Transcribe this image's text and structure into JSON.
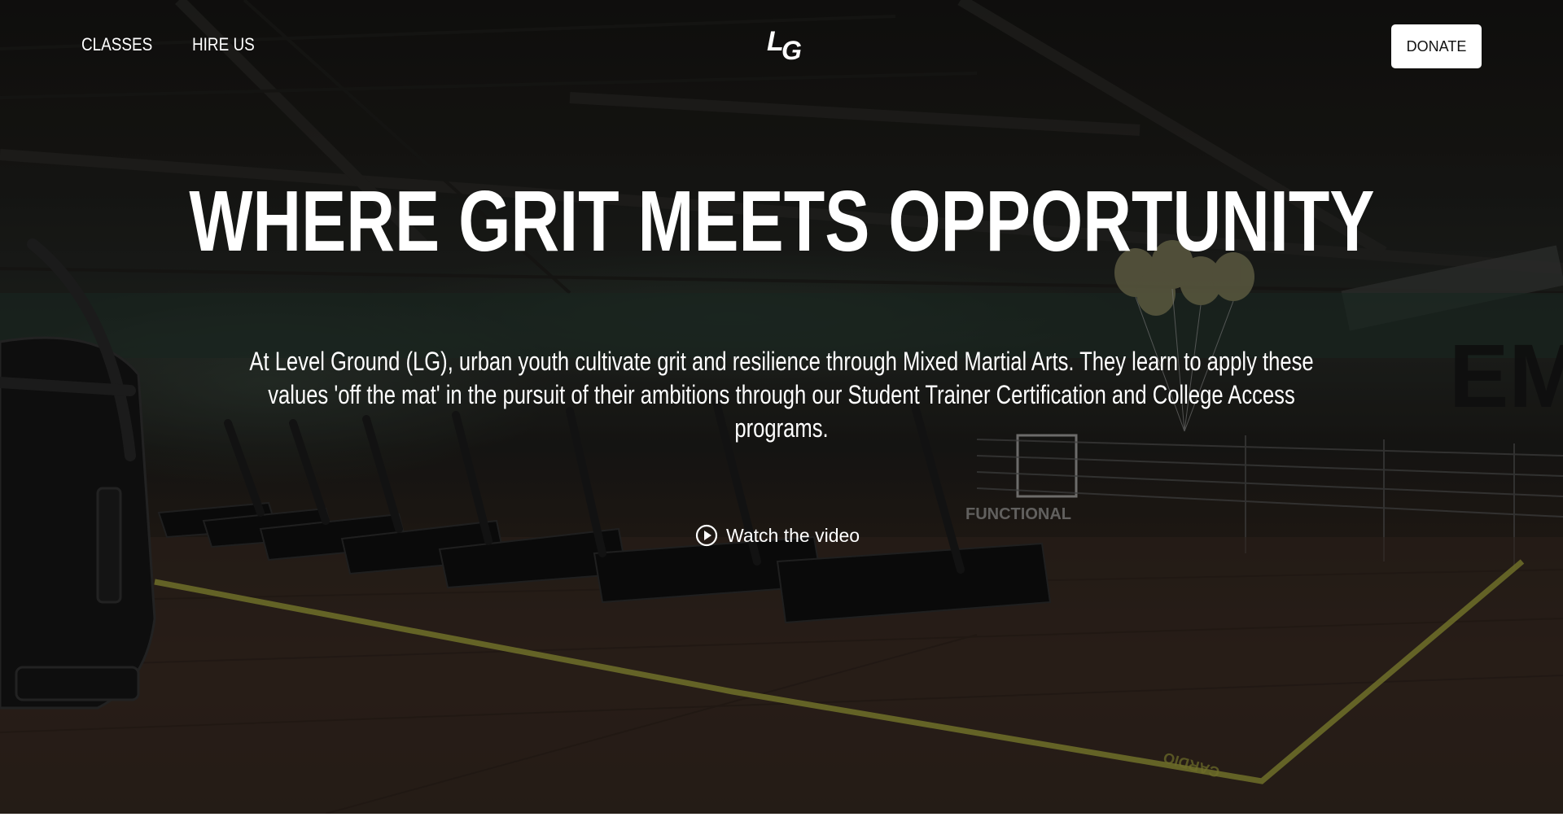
{
  "nav": {
    "items": [
      {
        "label": "CLASSES"
      },
      {
        "label": "HIRE US"
      }
    ],
    "logo": {
      "first": "L",
      "second": "G"
    },
    "donate_label": "DONATE"
  },
  "hero": {
    "headline": "WHERE GRIT MEETS OPPORTUNITY",
    "body": "At Level Ground (LG), urban youth cultivate grit and resilience through Mixed Martial Arts. They learn to apply these values 'off the mat' in the pursuit of their ambitions through our Student Trainer Certification and College Access programs.",
    "video_link": "Watch the video",
    "video_icon": "play-circle-icon"
  },
  "background": {
    "floor_markings": [
      "CARDIO"
    ],
    "wall_signs": [
      "FUNCTIONAL"
    ],
    "accent_colors": {
      "floor_line": "#9a9a3a",
      "overlay": "#000000"
    }
  }
}
